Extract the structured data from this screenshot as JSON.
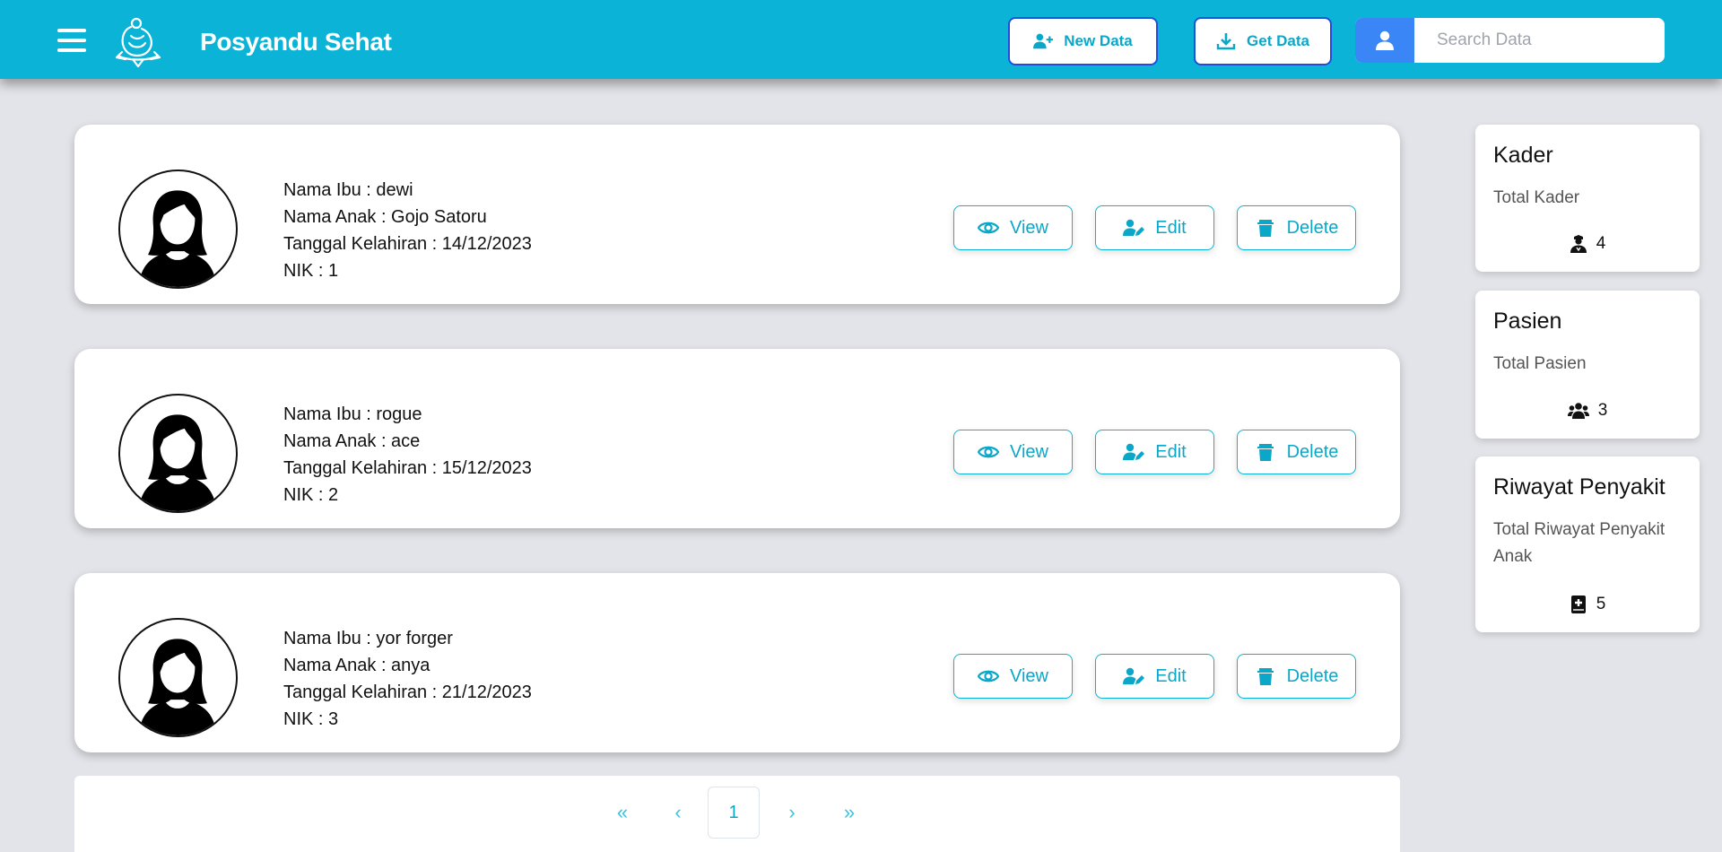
{
  "header": {
    "app_title": "Posyandu Sehat",
    "new_data_label": "New Data",
    "get_data_label": "Get Data",
    "search_placeholder": "Search Data",
    "brand_color": "#0bb4d7"
  },
  "cards": [
    {
      "nama_ibu": "Nama Ibu : dewi",
      "nama_anak": "Nama Anak : Gojo Satoru",
      "tanggal": "Tanggal Kelahiran : 14/12/2023",
      "nik": "NIK : 1"
    },
    {
      "nama_ibu": "Nama Ibu : rogue",
      "nama_anak": "Nama Anak : ace",
      "tanggal": "Tanggal Kelahiran : 15/12/2023",
      "nik": "NIK : 2"
    },
    {
      "nama_ibu": "Nama Ibu : yor forger",
      "nama_anak": "Nama Anak : anya",
      "tanggal": "Tanggal Kelahiran : 21/12/2023",
      "nik": "NIK : 3"
    }
  ],
  "actions": {
    "view": "View",
    "edit": "Edit",
    "delete": "Delete"
  },
  "pagination": {
    "first": "«",
    "prev": "‹",
    "current": "1",
    "next": "›",
    "last": "»"
  },
  "widgets": [
    {
      "title": "Kader",
      "subtitle": "Total Kader",
      "count": "4",
      "icon": "user-nurse-icon"
    },
    {
      "title": "Pasien",
      "subtitle": "Total Pasien",
      "count": "3",
      "icon": "users-icon"
    },
    {
      "title": "Riwayat Penyakit",
      "subtitle": "Total Riwayat Penyakit Anak",
      "count": "5",
      "icon": "medical-book-icon"
    }
  ]
}
